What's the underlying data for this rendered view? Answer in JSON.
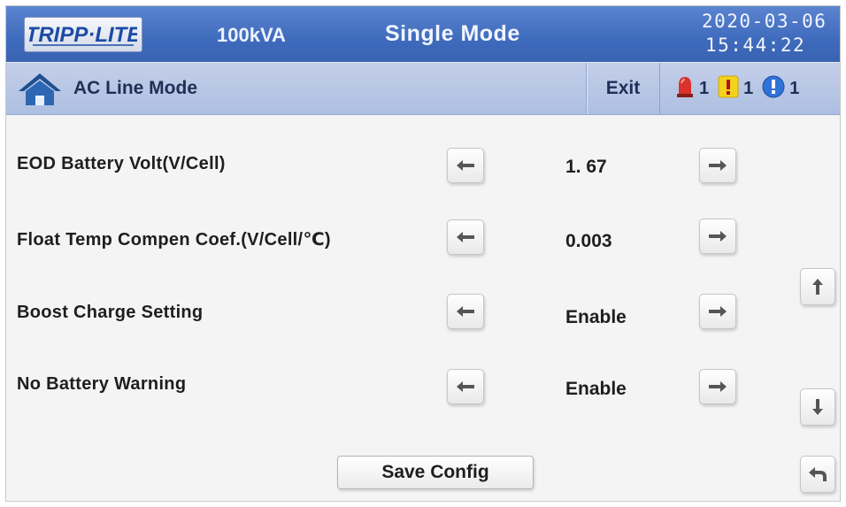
{
  "header": {
    "logo_text": "TRIPP·LITE",
    "model": "100kVA",
    "mode": "Single Mode",
    "date": "2020-03-06",
    "time": "15:44:22"
  },
  "status_bar": {
    "line_mode": "AC Line Mode",
    "exit_label": "Exit",
    "alarms": [
      {
        "icon": "red-alarm-light-icon",
        "count": "1"
      },
      {
        "icon": "yellow-warning-icon",
        "count": "1"
      },
      {
        "icon": "blue-info-icon",
        "count": "1"
      }
    ]
  },
  "settings": [
    {
      "label": "EOD Battery Volt(V/Cell)",
      "value": "1. 67"
    },
    {
      "label": "Float Temp Compen Coef.(V/Cell/℃)",
      "value": "0.003"
    },
    {
      "label": "Boost Charge Setting",
      "value": "Enable"
    },
    {
      "label": "No Battery Warning",
      "value": "Enable"
    }
  ],
  "buttons": {
    "save_label": "Save Config"
  },
  "colors": {
    "header_blue": "#3f6bbd",
    "status_bar": "#b8c6e6",
    "alarm_red": "#d8322a",
    "warning_yellow": "#f4d21c",
    "info_blue": "#2f73d8"
  }
}
